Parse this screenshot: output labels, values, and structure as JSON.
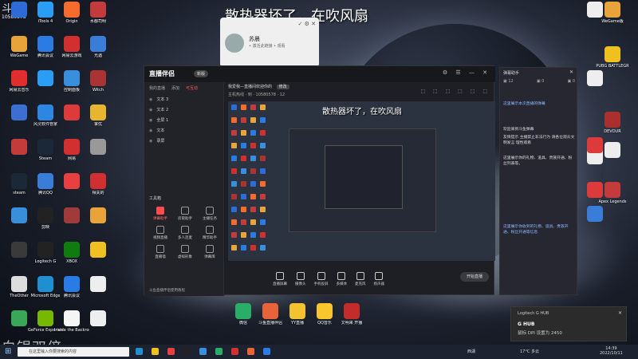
{
  "overlay": {
    "title": "散热器坏了，在吹风扇",
    "watermark_top": "斗鱼",
    "watermark_id": "10580578",
    "watermark_bottom": "白银双倍"
  },
  "desktop_left_icons": [
    {
      "label": "",
      "color": "#2e6bd6"
    },
    {
      "label": "iTools 4",
      "color": "#2a9df4"
    },
    {
      "label": "Origin",
      "color": "#f56c2d"
    },
    {
      "label": "水都司明",
      "color": "#c43b3b"
    },
    {
      "label": "WeGame",
      "color": "#e8a33a"
    },
    {
      "label": "腾讯会议",
      "color": "#2a7be4"
    },
    {
      "label": "网易云游戏",
      "color": "#d23030"
    },
    {
      "label": "光遇",
      "color": "#3a7dd8"
    },
    {
      "label": "网易云音乐",
      "color": "#e02e2e"
    },
    {
      "label": "",
      "color": "#2a9df4"
    },
    {
      "label": "控制面板",
      "color": "#3a8fdd"
    },
    {
      "label": "Witch",
      "color": "#aa3333"
    },
    {
      "label": "",
      "color": "#3b6fd1"
    },
    {
      "label": "风灵软件管家",
      "color": "#2c86e2"
    },
    {
      "label": "",
      "color": "#dd3b3b"
    },
    {
      "label": "掌优",
      "color": "#e8b52e"
    },
    {
      "label": "",
      "color": "#c43b3b"
    },
    {
      "label": "Steam",
      "color": "#1b2838"
    },
    {
      "label": "网易",
      "color": "#d23030"
    },
    {
      "label": "",
      "color": "#999999"
    },
    {
      "label": "steam",
      "color": "#1b2838"
    },
    {
      "label": "腾讯QQ",
      "color": "#3a7dd8"
    },
    {
      "label": "",
      "color": "#e84040"
    },
    {
      "label": "相关的",
      "color": "#d23030"
    },
    {
      "label": "",
      "color": "#3a8fdd"
    },
    {
      "label": "剪映",
      "color": "#222222"
    },
    {
      "label": "",
      "color": "#9f3b3b"
    },
    {
      "label": "",
      "color": "#e8a33a"
    },
    {
      "label": "",
      "color": "#3a3a3a"
    },
    {
      "label": "Logitech G",
      "color": "#222222"
    },
    {
      "label": "XBOX",
      "color": "#107c10"
    },
    {
      "label": "",
      "color": "#f0c020"
    },
    {
      "label": "TheOther",
      "color": "#dddddd"
    },
    {
      "label": "Microsoft Edge",
      "color": "#1f8fd0"
    },
    {
      "label": "腾讯会议",
      "color": "#2a7be4"
    },
    {
      "label": "",
      "color": "#eeeeee"
    },
    {
      "label": "",
      "color": "#3aa657"
    },
    {
      "label": "GeForce Experience",
      "color": "#76b900"
    },
    {
      "label": "Inside the Backroom",
      "color": "#f5f5f5"
    },
    {
      "label": "",
      "color": "#eeeeee"
    }
  ],
  "desktop_right_icons": [
    {
      "label": "",
      "color": "#eeeeee"
    },
    {
      "label": "WeGame版",
      "color": "#e8a33a"
    },
    {
      "label": "PUBG BATTLEGR",
      "color": "#f0c020"
    },
    {
      "label": "",
      "color": "#eeeeee"
    },
    {
      "label": "DEVOUR",
      "color": "#aa3030"
    },
    {
      "label": "",
      "color": "#eeeeee"
    },
    {
      "label": "",
      "color": "#dd3b3b"
    },
    {
      "label": "",
      "color": "#eeeeee"
    },
    {
      "label": "",
      "color": "#dd3b3b"
    },
    {
      "label": "Apex Legends",
      "color": "#c43b3b"
    },
    {
      "label": "",
      "color": "#3a7dd8"
    }
  ],
  "profile_card": {
    "name": "苏晨",
    "subtitle": "• 激活此链接 • 观看"
  },
  "app": {
    "logo": "直播伴侣",
    "badge": "新版",
    "left_tabs": [
      "我的直播",
      "添加",
      "可互动"
    ],
    "scenes": [
      "文本 3",
      "文本 2",
      "全屏 1",
      "文本",
      "录屏"
    ],
    "tools_title": "工具箱",
    "tools": [
      {
        "label": "弹幕助手",
        "active": true
      },
      {
        "label": "房管助手",
        "active": false
      },
      {
        "label": "主播任务",
        "active": false
      },
      {
        "label": "视频直播",
        "active": false
      },
      {
        "label": "多人连麦",
        "active": false
      },
      {
        "label": "精华助手",
        "active": false
      },
      {
        "label": "直播墙",
        "active": false
      },
      {
        "label": "虚拟形象",
        "active": false
      },
      {
        "label": "弹幕库",
        "active": false
      }
    ],
    "footer": "斗鱼直播伴侣使用教程",
    "room_title": "我爱我—直播间欢迎你的",
    "room_tag": "修改",
    "room_meta": "主机热线 · 到 · 10580578 · 12",
    "bottom_buttons": [
      "直播屏幕",
      "摄像头",
      "手机投屏",
      "多媒体",
      "麦克风",
      "扬声器"
    ],
    "start_button": "开始直播"
  },
  "right_panel": {
    "title": "弹幕助手",
    "tabs": [
      "12",
      "0",
      "0"
    ],
    "lines": [
      "这里展示本次直播的弹幕",
      "欢迎来到斗鱼弹幕",
      "友情提示 主播禁止非法行为 请各位观众文明发言 理性观看",
      "这里展示你的礼物、道具、贵族开通、粉丝列表等。",
      "这里展示你收到的礼物、道具、贵族开通、粉丝开通等信息"
    ]
  },
  "toast": {
    "app": "Logitech G HUB",
    "title": "G HUB",
    "body": "鼠标 DPI 设置为 2450"
  },
  "center_icons": [
    {
      "label": "微信",
      "color": "#2aae67"
    },
    {
      "label": "斗鱼直播伴侣",
      "color": "#e8633a"
    },
    {
      "label": "YY直播",
      "color": "#f2c230"
    },
    {
      "label": "QQ音乐",
      "color": "#f7c52c"
    },
    {
      "label": "文明来 开播",
      "color": "#c42b2b"
    }
  ],
  "taskbar": {
    "search_placeholder": "在这里输入你要搜索的内容",
    "tray_text": "西湖",
    "weather": "17°C 多云",
    "time": "14:39",
    "date": "2022/10/11"
  }
}
